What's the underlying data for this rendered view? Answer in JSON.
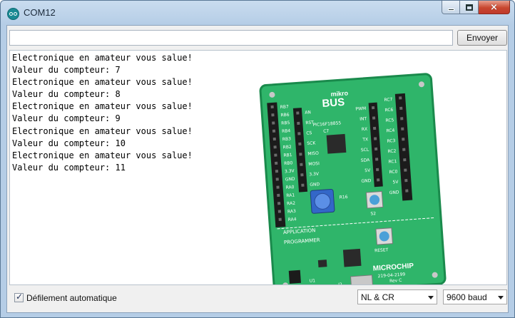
{
  "window": {
    "title": "COM12",
    "icon": "arduino-icon",
    "controls": {
      "minimize": "minimize-icon",
      "maximize": "maximize-icon",
      "close": "×"
    }
  },
  "send": {
    "input_value": "",
    "button_label": "Envoyer"
  },
  "output": {
    "lines": [
      "Electronique en amateur vous salue!",
      "Valeur du compteur: 7",
      "Electronique en amateur vous salue!",
      "Valeur du compteur: 8",
      "Electronique en amateur vous salue!",
      "Valeur du compteur: 9",
      "Electronique en amateur vous salue!",
      "Valeur du compteur: 10",
      "Electronique en amateur vous salue!",
      "Valeur du compteur: 11"
    ]
  },
  "board": {
    "mikrobus_small": "mikro",
    "mikrobus_big": "BUS",
    "chip_label": "PIC16F18855",
    "c7": "C7",
    "r16": "R16",
    "s2": "S2",
    "application": "APPLICATION",
    "programmer": "PROGRAMMER",
    "reset": "RESET",
    "brand": "MICROCHIP",
    "part_number": "219-04-2199",
    "revision": "Rev C",
    "j2": "J2",
    "u1": "U1",
    "left_pins": [
      "RB7",
      "RB6",
      "RB5",
      "RB4",
      "RB3",
      "RB2",
      "RB1",
      "RB0",
      "3.3V",
      "GND",
      "RA0",
      "RA1",
      "RA2",
      "RA3",
      "RA4"
    ],
    "mikro_left_pins": [
      "AN",
      "RST",
      "CS",
      "SCK",
      "MISO",
      "MOSI",
      "3.3V",
      "GND"
    ],
    "mikro_right_pins": [
      "PWM",
      "INT",
      "RX",
      "TX",
      "SCL",
      "SDA",
      "5V",
      "GND"
    ],
    "right_pins": [
      "RC7",
      "RC6",
      "RC5",
      "RC4",
      "RC3",
      "RC2",
      "RC1",
      "RC0",
      "5V",
      "GND"
    ]
  },
  "footer": {
    "autoscroll_label": "Défilement automatique",
    "autoscroll_checked": true,
    "line_ending": "NL & CR",
    "baud_rate": "9600 baud"
  },
  "colors": {
    "board_green": "#2fb56a",
    "board_dark": "#1a8a4c",
    "header_black": "#1b1b1b"
  }
}
